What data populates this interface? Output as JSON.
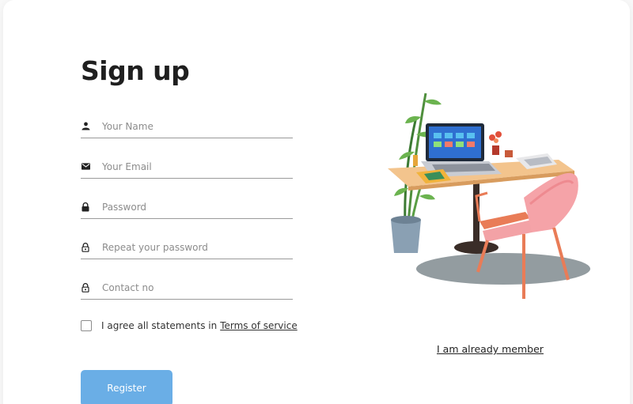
{
  "form": {
    "title": "Sign up",
    "fields": [
      {
        "icon": "person-icon",
        "placeholder": "Your Name"
      },
      {
        "icon": "envelope-icon",
        "placeholder": "Your Email"
      },
      {
        "icon": "lock-icon",
        "placeholder": "Password"
      },
      {
        "icon": "lock-outline-icon",
        "placeholder": "Repeat your password"
      },
      {
        "icon": "lock-outline-icon",
        "placeholder": "Contact no"
      }
    ],
    "agree_text": "I agree all statements in",
    "terms_link": "Terms of service",
    "register_label": "Register"
  },
  "aside": {
    "member_link": "I am already member"
  },
  "colors": {
    "accent": "#6aaee6",
    "chair": "#f09aa0"
  }
}
